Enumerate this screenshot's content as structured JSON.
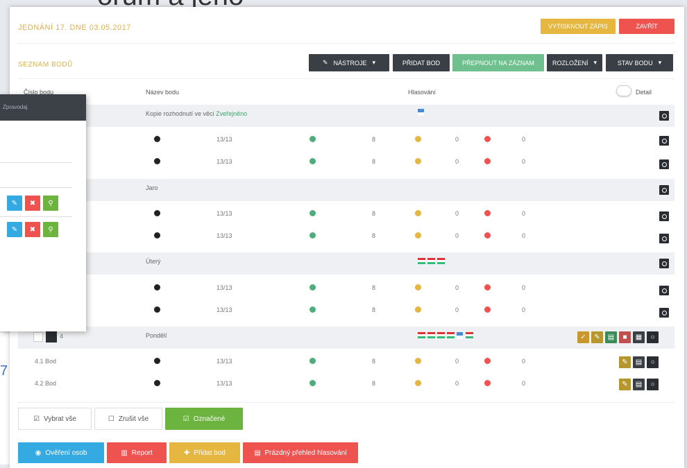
{
  "background": {
    "partial_title": "orum a jeho",
    "side_number": "7"
  },
  "header": {
    "title": "JEDNÁNÍ 17. DNE 03.05.2017",
    "print_label": "VYTISKNOUT ZÁPIS",
    "close_label": "ZAVŘÍT"
  },
  "section": {
    "title": "SEZNAM BODŮ",
    "toolbar": {
      "tools_label": "NÁSTROJE",
      "add_point_label": "PŘIDAT BOD",
      "record_label": "PŘEPNOUT NA ZÁZNAM",
      "layout_label": "ROZLOŽENÍ",
      "status_label": "STAV BODU"
    }
  },
  "table": {
    "col_number": "Číslo bodu",
    "col_name": "Název bodu",
    "col_voting": "Hlasování",
    "toggle_label": "Detail",
    "groups": [
      {
        "name": "Kopie rozhodnutí ve věci",
        "link": "Zveřejněno"
      },
      {
        "name": "Jaro"
      },
      {
        "name": "Úterý"
      },
      {
        "name": "Pondělí",
        "number": "4"
      }
    ],
    "rows": [
      {
        "label": "",
        "score": "13/13"
      },
      {
        "label": "",
        "score": "13/13"
      },
      {
        "label": "",
        "score": "13/13"
      },
      {
        "label": "",
        "score": "13/13"
      },
      {
        "label": "",
        "score": "13/13"
      },
      {
        "label": "",
        "score": "13/13"
      },
      {
        "label": "4.1 Bod",
        "score": "13/13"
      },
      {
        "label": "4.2 Bod",
        "score": "13/13"
      }
    ],
    "yes_count": "8",
    "abstain_count": "0",
    "no_count": "0"
  },
  "selection": {
    "select_all": "Vybrat vše",
    "deselect_all": "Zrušit vše",
    "selected": "Označené"
  },
  "actions": {
    "verify": "Ověření osob",
    "report": "Report",
    "add_point": "Přidat bod",
    "print_layout": "Prázdný přehled hlasování"
  },
  "popup": {
    "header": "Zpravodaj"
  },
  "colors": {
    "gold": "#e5b640",
    "red": "#ef5350",
    "dark": "#3a3f45",
    "green": "#6fbf8f",
    "blue": "#35a9e1",
    "lime": "#6cb33f"
  }
}
